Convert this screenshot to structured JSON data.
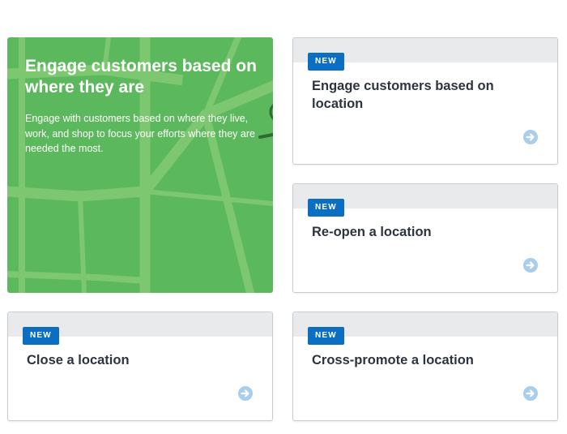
{
  "hero": {
    "title": "Engage customers based on where they are",
    "description": "Engage with customers based on where they live, work, and shop to focus your efforts where they are needed the most."
  },
  "cards": [
    {
      "badge": "NEW",
      "title": "Engage customers based on location",
      "icon": "arrow-circle-right-icon"
    },
    {
      "badge": "NEW",
      "title": "Re-open a location",
      "icon": "arrow-circle-right-icon"
    },
    {
      "badge": "NEW",
      "title": "Close a location",
      "icon": "arrow-circle-right-icon"
    },
    {
      "badge": "NEW",
      "title": "Cross-promote a location",
      "icon": "arrow-circle-right-icon"
    }
  ],
  "colors": {
    "hero_bg": "#5cb85c",
    "badge_bg": "#0a6fc2",
    "arrow_icon": "#a9cdea"
  }
}
